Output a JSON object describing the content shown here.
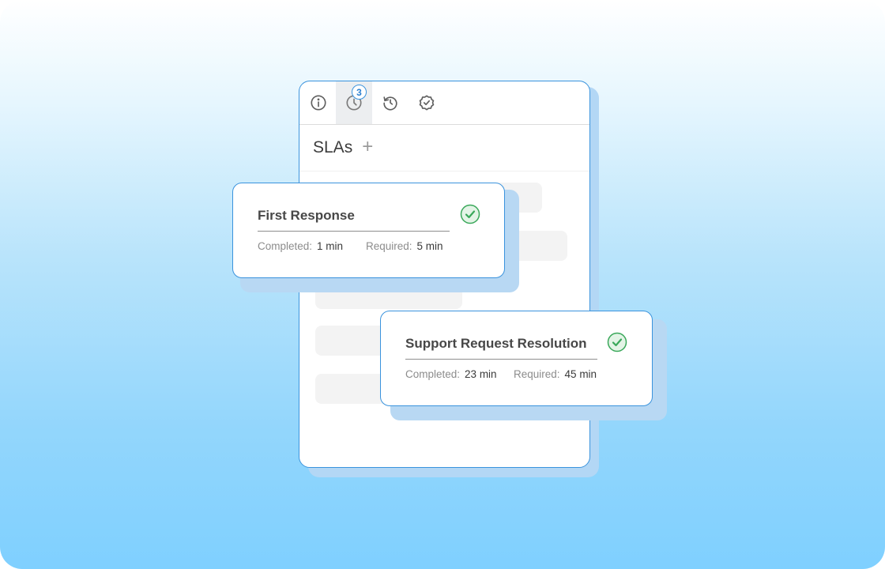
{
  "tabs": [
    {
      "name": "info",
      "icon": "info-icon"
    },
    {
      "name": "sla",
      "icon": "clock-icon",
      "badge": "3",
      "active": true
    },
    {
      "name": "history",
      "icon": "history-icon"
    },
    {
      "name": "verified",
      "icon": "badge-check-icon"
    }
  ],
  "panel": {
    "title": "SLAs",
    "add_label": "+"
  },
  "cards": [
    {
      "title": "First Response",
      "completed_label": "Completed:",
      "completed_value": "1 min",
      "required_label": "Required:",
      "required_value": "5 min",
      "status": "met"
    },
    {
      "title": "Support Request Resolution",
      "completed_label": "Completed:",
      "completed_value": "23 min",
      "required_label": "Required:",
      "required_value": "45 min",
      "status": "met"
    }
  ],
  "colors": {
    "accent": "#3a93dd",
    "success": "#3aa85a",
    "success_bg": "#e3f4e6"
  }
}
